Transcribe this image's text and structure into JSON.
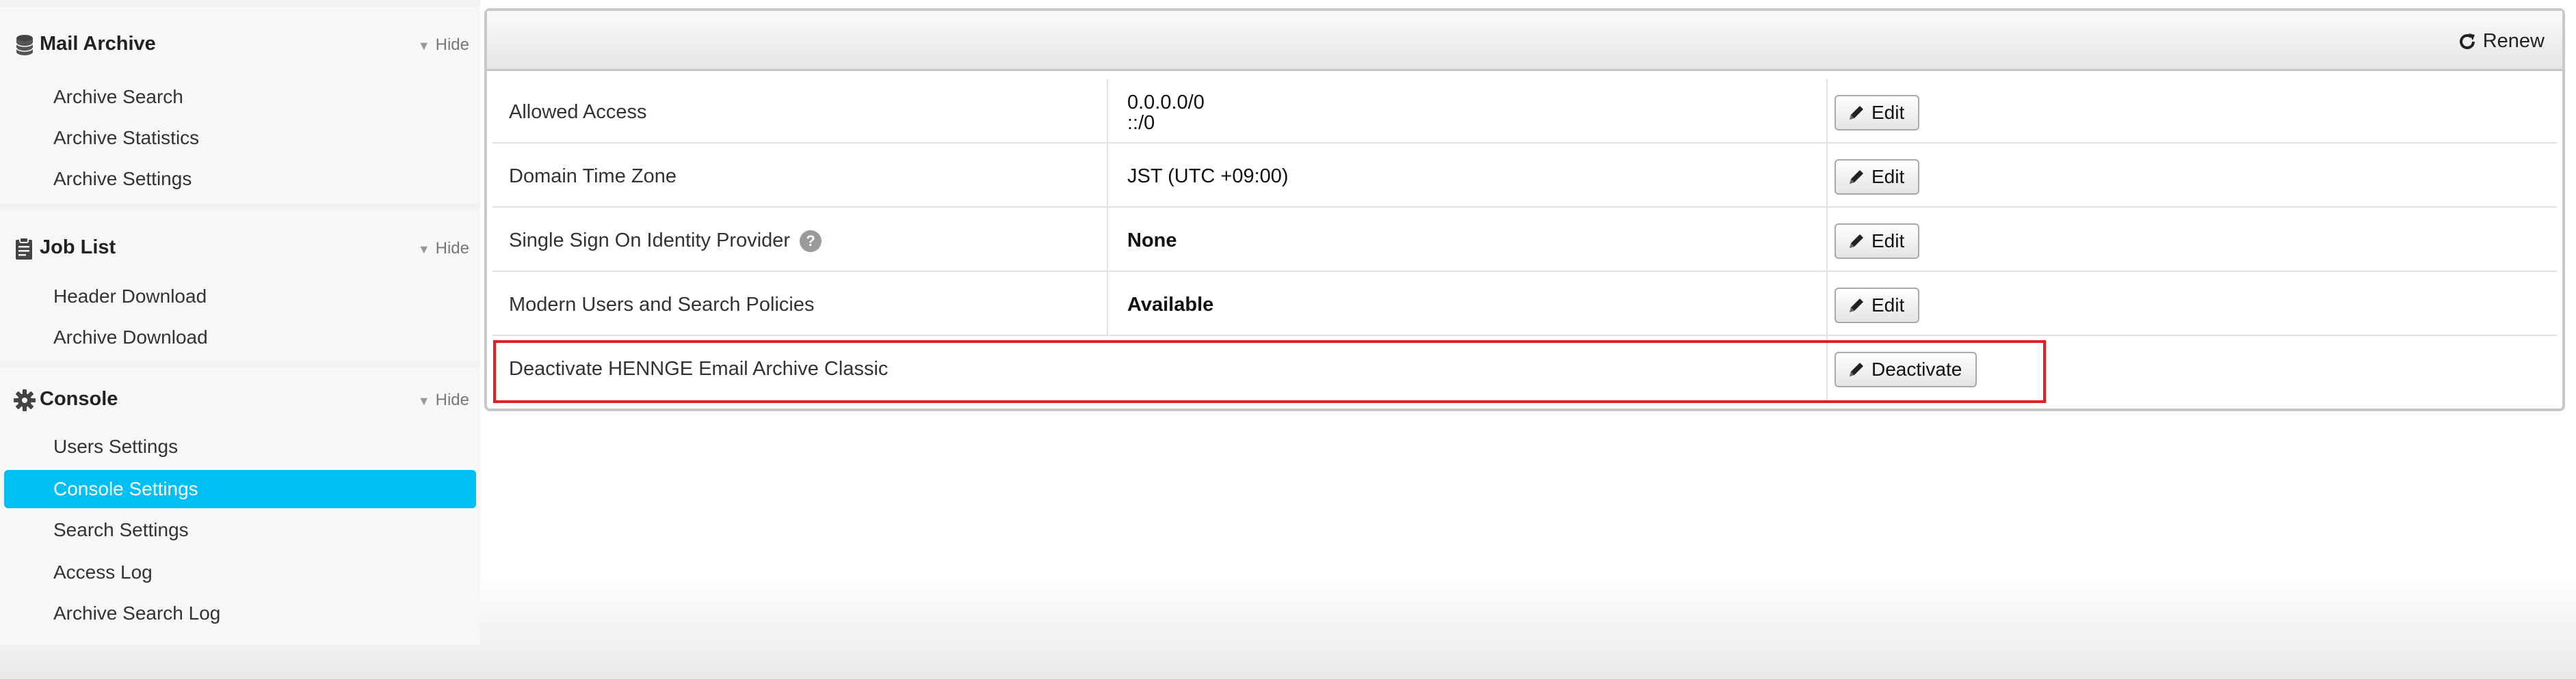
{
  "sidebar": {
    "sections": [
      {
        "title": "Mail Archive",
        "hide_label": "Hide",
        "items": [
          "Archive Search",
          "Archive Statistics",
          "Archive Settings"
        ]
      },
      {
        "title": "Job List",
        "hide_label": "Hide",
        "items": [
          "Header Download",
          "Archive Download"
        ]
      },
      {
        "title": "Console",
        "hide_label": "Hide",
        "items": [
          "Users Settings",
          "Console Settings",
          "Search Settings",
          "Access Log",
          "Archive Search Log"
        ]
      }
    ],
    "active_item": "Console Settings"
  },
  "toolbar": {
    "renew_label": "Renew"
  },
  "settings": {
    "rows": [
      {
        "label": "Allowed Access",
        "value_lines": [
          "0.0.0.0/0",
          "::/0"
        ],
        "button": "Edit"
      },
      {
        "label": "Domain Time Zone",
        "value": "JST (UTC +09:00)",
        "button": "Edit"
      },
      {
        "label": "Single Sign On Identity Provider",
        "help": "?",
        "value": "None",
        "button": "Edit"
      },
      {
        "label": "Modern Users and Search Policies",
        "value": "Available",
        "button": "Edit"
      },
      {
        "label": "Deactivate HENNGE Email Archive Classic",
        "button": "Deactivate"
      }
    ]
  },
  "colors": {
    "active_item": "#00bff3",
    "highlight_border": "#e0201f"
  },
  "icons": {
    "mail_archive": "database-icon",
    "job_list": "clipboard-icon",
    "console": "gear-icon",
    "renew": "refresh-icon",
    "edit": "pencil-icon",
    "help": "question-circle-icon"
  }
}
